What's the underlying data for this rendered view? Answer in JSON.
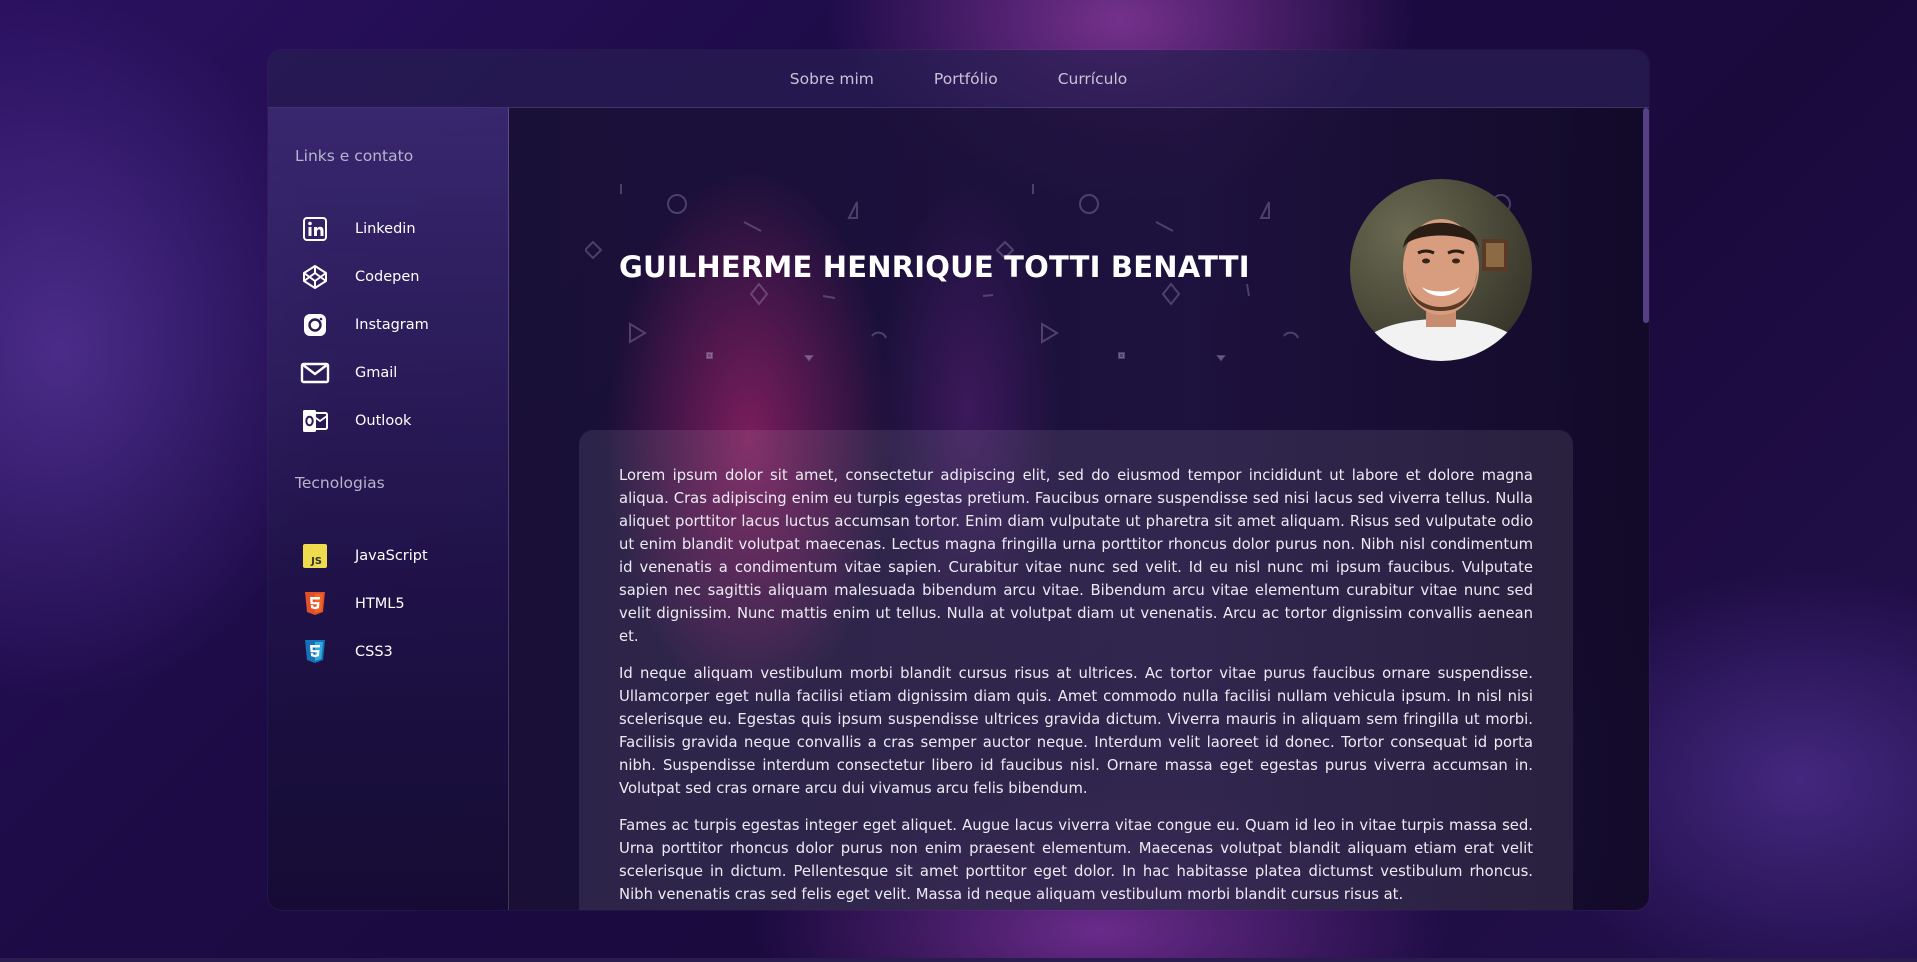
{
  "nav": {
    "items": [
      {
        "label": "Sobre mim"
      },
      {
        "label": "Portfólio"
      },
      {
        "label": "Currículo"
      }
    ]
  },
  "sidebar": {
    "links_heading": "Links e contato",
    "links": [
      {
        "label": "Linkedin",
        "icon": "linkedin-icon"
      },
      {
        "label": "Codepen",
        "icon": "codepen-icon"
      },
      {
        "label": "Instagram",
        "icon": "instagram-icon"
      },
      {
        "label": "Gmail",
        "icon": "gmail-icon"
      },
      {
        "label": "Outlook",
        "icon": "outlook-icon"
      }
    ],
    "tech_heading": "Tecnologias",
    "tech": [
      {
        "label": "JavaScript",
        "icon": "javascript-icon",
        "color": "#f0db4f"
      },
      {
        "label": "HTML5",
        "icon": "html5-icon",
        "color": "#e34f26"
      },
      {
        "label": "CSS3",
        "icon": "css3-icon",
        "color": "#1572b6"
      }
    ]
  },
  "profile": {
    "name": "GUILHERME HENRIQUE TOTTI BENATTI"
  },
  "about": {
    "paragraphs": [
      "Lorem ipsum dolor sit amet, consectetur adipiscing elit, sed do eiusmod tempor incididunt ut labore et dolore magna aliqua. Cras adipiscing enim eu turpis egestas pretium. Faucibus ornare suspendisse sed nisi lacus sed viverra tellus. Nulla aliquet porttitor lacus luctus accumsan tortor. Enim diam vulputate ut pharetra sit amet aliquam. Risus sed vulputate odio ut enim blandit volutpat maecenas. Lectus magna fringilla urna porttitor rhoncus dolor purus non. Nibh nisl condimentum id venenatis a condimentum vitae sapien. Curabitur vitae nunc sed velit. Id eu nisl nunc mi ipsum faucibus. Vulputate sapien nec sagittis aliquam malesuada bibendum arcu vitae. Bibendum arcu vitae elementum curabitur vitae nunc sed velit dignissim. Nunc mattis enim ut tellus. Nulla at volutpat diam ut venenatis. Arcu ac tortor dignissim convallis aenean et.",
      "Id neque aliquam vestibulum morbi blandit cursus risus at ultrices. Ac tortor vitae purus faucibus ornare suspendisse. Ullamcorper eget nulla facilisi etiam dignissim diam quis. Amet commodo nulla facilisi nullam vehicula ipsum. In nisl nisi scelerisque eu. Egestas quis ipsum suspendisse ultrices gravida dictum. Viverra mauris in aliquam sem fringilla ut morbi. Facilisis gravida neque convallis a cras semper auctor neque. Interdum velit laoreet id donec. Tortor consequat id porta nibh. Suspendisse interdum consectetur libero id faucibus nisl. Ornare massa eget egestas purus viverra accumsan in. Volutpat sed cras ornare arcu dui vivamus arcu felis bibendum.",
      "Fames ac turpis egestas integer eget aliquet. Augue lacus viverra vitae congue eu. Quam id leo in vitae turpis massa sed. Urna porttitor rhoncus dolor purus non enim praesent elementum. Maecenas volutpat blandit aliquam etiam erat velit scelerisque in dictum. Pellentesque sit amet porttitor eget dolor. In hac habitasse platea dictumst vestibulum rhoncus. Nibh venenatis cras sed felis eget velit. Massa id neque aliquam vestibulum morbi blandit cursus risus at."
    ]
  }
}
